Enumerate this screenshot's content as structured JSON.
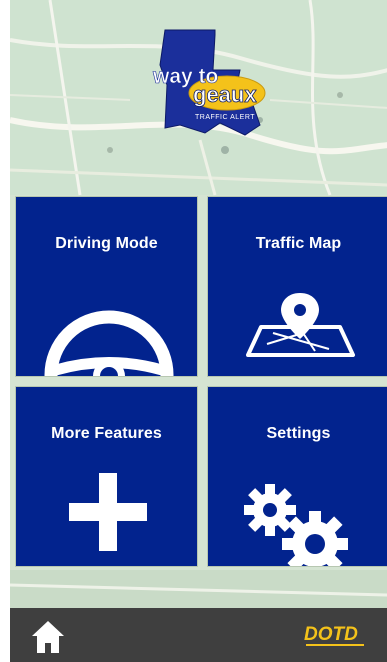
{
  "app": {
    "logo": {
      "word1": "way to",
      "word2": "geaux",
      "tagline": "TRAFFIC ALERT"
    }
  },
  "tiles": [
    {
      "label": "Driving Mode",
      "icon": "steering-wheel-icon"
    },
    {
      "label": "Traffic Map",
      "icon": "map-pin-icon"
    },
    {
      "label": "More Features",
      "icon": "plus-icon"
    },
    {
      "label": "Settings",
      "icon": "gears-icon"
    }
  ],
  "bottom_bar": {
    "home_icon": "home-icon",
    "brand": "DOTD"
  },
  "colors": {
    "tile_blue": "#02238e",
    "bottom_bar": "#3f3f3f",
    "brand_yellow": "#f4c21a",
    "map_green": "#cfe0cf"
  }
}
